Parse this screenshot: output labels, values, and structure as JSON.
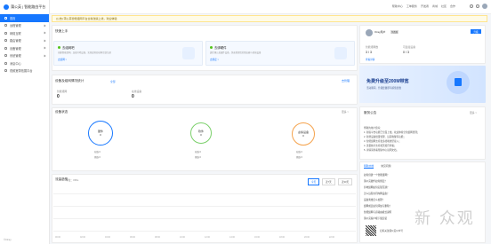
{
  "brand": {
    "name": "蒲公英 | 智能路由平台",
    "color": "#1677ff"
  },
  "sidebar": {
    "items": [
      {
        "label": "首页",
        "active": true
      },
      {
        "label": "远程管理"
      },
      {
        "label": "网络互联"
      },
      {
        "label": "路由管理"
      },
      {
        "label": "设备管理"
      },
      {
        "label": "系统管理"
      },
      {
        "label": "消息中心"
      },
      {
        "label": "视频宽带拓展平台"
      }
    ],
    "footer": "©Oray"
  },
  "topbar": {
    "links": [
      "帮助中心",
      "工单服务",
      "开发者",
      "商城",
      "社区",
      "合作"
    ],
    "user": "Oray用户"
  },
  "notice": "[公告] 蒲公英智能组网平台全新改版上线，欢迎体验",
  "quick": {
    "title": "快速上手",
    "cards": [
      {
        "title": "去组网吧",
        "desc": "创建智能组网，连接异地设备，实现虚拟局域网互联互通",
        "action": "去组网 >"
      },
      {
        "title": "去绑硬件",
        "desc": "绑定蒲公英硬件设备，快速管理您的路由器与终端设备",
        "action": "去绑定 >"
      }
    ]
  },
  "overview": {
    "title": "设备及组网情况统计",
    "tag": "全部",
    "link": "去管理",
    "stats": [
      {
        "label": "智能组网",
        "value": "0"
      },
      {
        "label": "在线设备",
        "value": "0"
      }
    ]
  },
  "status": {
    "title": "设备状态",
    "more": "更多 >",
    "rings": [
      {
        "name": "硬件",
        "sub": "设备数",
        "value": "0",
        "color": "#1677ff",
        "rows": [
          [
            "在线",
            "0"
          ],
          [
            "离线",
            "0"
          ]
        ]
      },
      {
        "name": "软件",
        "sub": "终端数",
        "value": "0",
        "color": "#7bd06b",
        "rows": [
          [
            "在线",
            "0"
          ],
          [
            "离线",
            "0"
          ]
        ]
      },
      {
        "name": "虚拟设备",
        "sub": "设备数",
        "value": "0",
        "color": "#f5a34d",
        "rows": [
          [
            "在线",
            "0"
          ],
          [
            "离线",
            "0"
          ]
        ]
      }
    ]
  },
  "traffic": {
    "title": "流量趋势",
    "unit": "单位：KB/s",
    "buttons": [
      "今天",
      "近7天",
      "近30天"
    ],
    "active_button": 0,
    "x_ticks": [
      "00:00",
      "02:00",
      "04:00",
      "06:00",
      "08:00",
      "10:00",
      "12:00",
      "14:00",
      "16:00",
      "18:00",
      "20:00",
      "22:00"
    ]
  },
  "account": {
    "name": "Oray用户",
    "tag": "免费版",
    "button": "升级",
    "stat1_label": "智能组网数",
    "stat1_value": "3 / 3",
    "stat2_label": "可连接设备",
    "stat2_value": "0 / 3",
    "stat_link": "查看详情"
  },
  "banner": {
    "title": "免费升级至200M带宽",
    "sub": "活动期间，升级套餐即享超值优惠"
  },
  "news": {
    "title": "服务公告",
    "more": "更多 >",
    "lines": [
      "尊敬的用户您好：",
      "1. 新版平台功能已全面上线，欢迎体验全新组网管理；",
      "2. 新增设备批量管理、远程唤醒等功能；",
      "3. 智能组网支持更多终端类型接入；",
      "4. 流量统计支持按天按月查看；",
      "5. 详情请查看帮助中心说明文档。"
    ]
  },
  "help": {
    "tabs": [
      "帮助文档",
      "常见问题"
    ],
    "items": [
      "如何创建一个智能组网？",
      "蒲公英硬件如何绑定？",
      "异地组网如何实现互通？",
      "怎么远程访问内网设备？",
      "设备离线怎么处理？",
      "组网成员如何添加与删除？",
      "智能组网与旁路由模式说明",
      "蒲公英客户端下载安装"
    ],
    "qr_label": "扫码关注蒲公英公众号"
  },
  "watermark": "新 众观"
}
